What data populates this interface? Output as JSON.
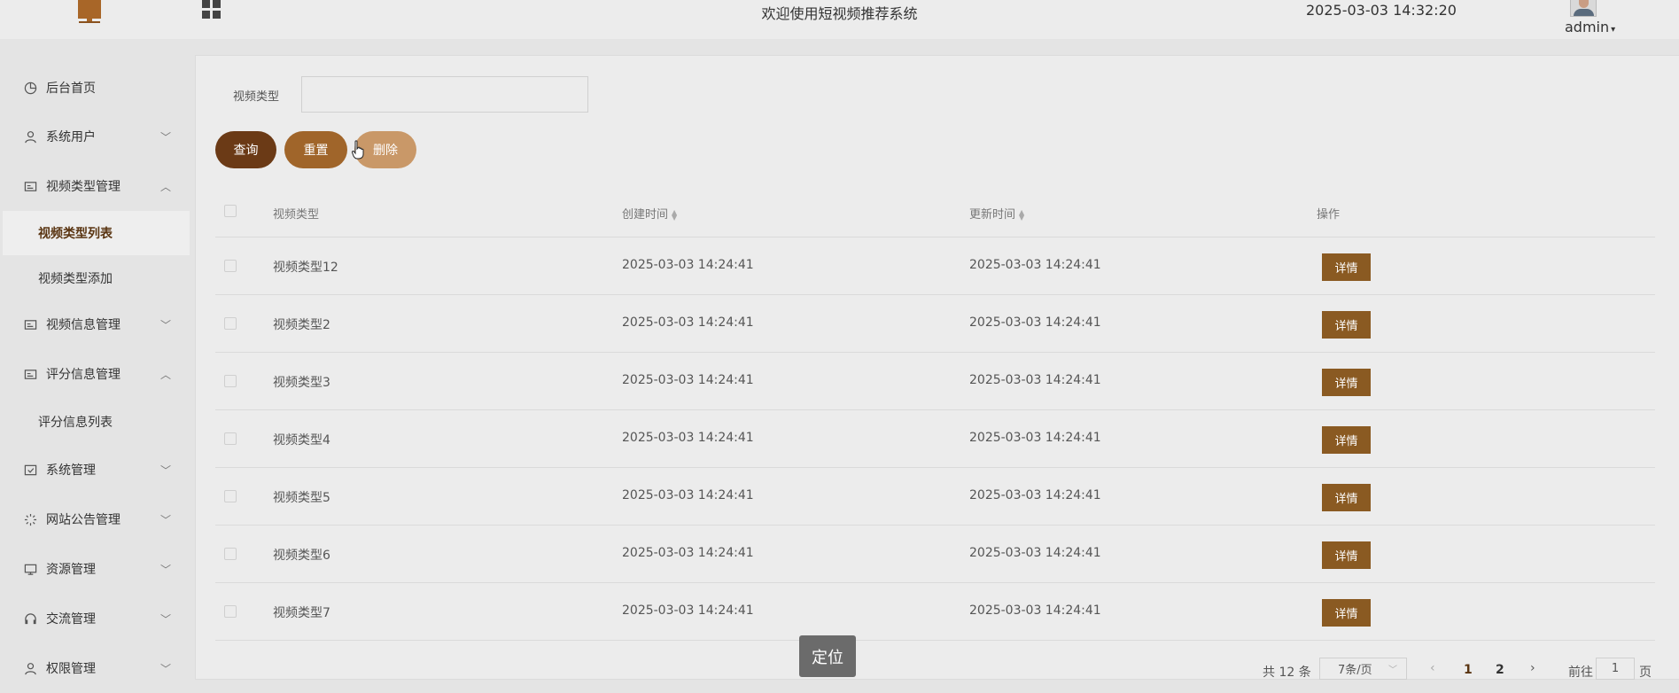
{
  "header": {
    "site_title": "欢迎使用短视频推荐系统",
    "datetime": "2025-03-03 14:32:20",
    "username": "admin"
  },
  "sidebar": {
    "items": [
      {
        "label": "后台首页"
      },
      {
        "label": "系统用户"
      },
      {
        "label": "视频类型管理"
      },
      {
        "label": "视频类型列表"
      },
      {
        "label": "视频类型添加"
      },
      {
        "label": "视频信息管理"
      },
      {
        "label": "评分信息管理"
      },
      {
        "label": "评分信息列表"
      },
      {
        "label": "系统管理"
      },
      {
        "label": "网站公告管理"
      },
      {
        "label": "资源管理"
      },
      {
        "label": "交流管理"
      },
      {
        "label": "权限管理"
      }
    ]
  },
  "search": {
    "label": "视频类型",
    "value": ""
  },
  "buttons": {
    "query": "查询",
    "reset": "重置",
    "delete": "删除",
    "detail": "详情"
  },
  "table": {
    "columns": [
      "视频类型",
      "创建时间",
      "更新时间",
      "操作"
    ],
    "rows": [
      {
        "type": "视频类型12",
        "created": "2025-03-03 14:24:41",
        "updated": "2025-03-03 14:24:41"
      },
      {
        "type": "视频类型2",
        "created": "2025-03-03 14:24:41",
        "updated": "2025-03-03 14:24:41"
      },
      {
        "type": "视频类型3",
        "created": "2025-03-03 14:24:41",
        "updated": "2025-03-03 14:24:41"
      },
      {
        "type": "视频类型4",
        "created": "2025-03-03 14:24:41",
        "updated": "2025-03-03 14:24:41"
      },
      {
        "type": "视频类型5",
        "created": "2025-03-03 14:24:41",
        "updated": "2025-03-03 14:24:41"
      },
      {
        "type": "视频类型6",
        "created": "2025-03-03 14:24:41",
        "updated": "2025-03-03 14:24:41"
      },
      {
        "type": "视频类型7",
        "created": "2025-03-03 14:24:41",
        "updated": "2025-03-03 14:24:41"
      }
    ]
  },
  "pagination": {
    "total": "共 12 条",
    "page_size": "7条/页",
    "pages": [
      "1",
      "2"
    ],
    "goto_label": "前往",
    "goto_value": "1",
    "page_suffix": "页"
  },
  "toast": "定位",
  "colors": {
    "primary_dark": "#6b3a16",
    "primary": "#a0652a",
    "primary_light": "#c99868",
    "detail_button": "#8a5a22"
  }
}
